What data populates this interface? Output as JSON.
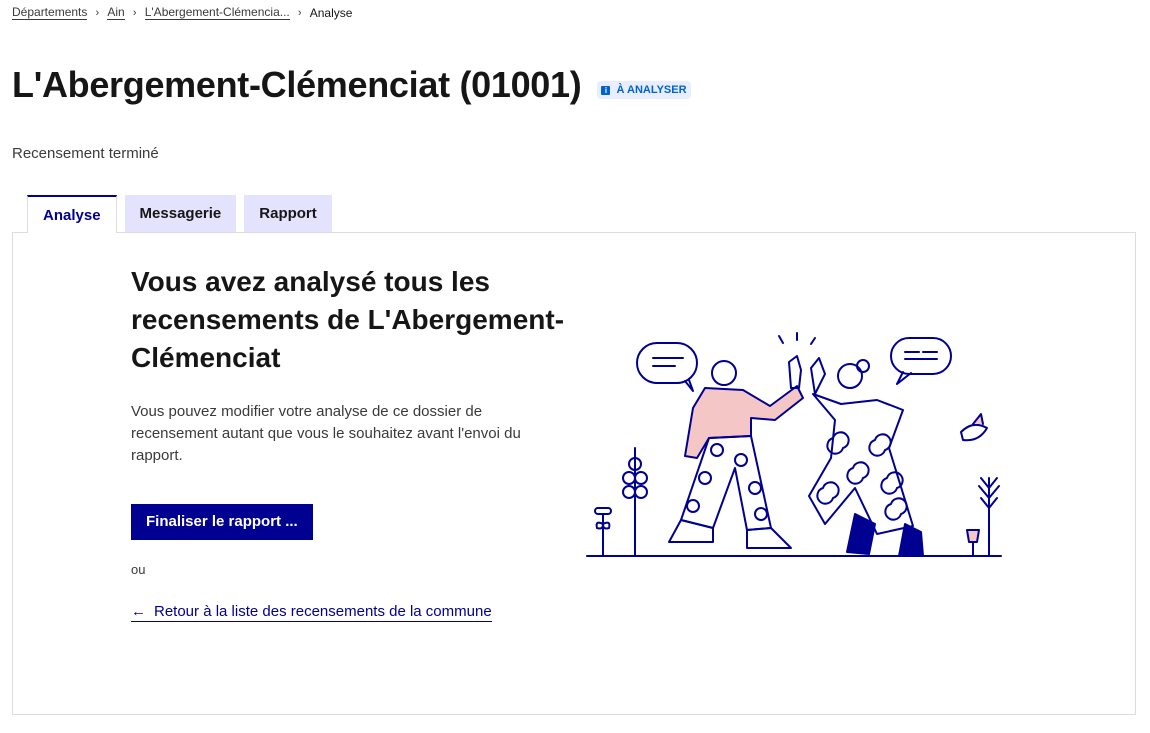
{
  "breadcrumb": {
    "items": [
      "Départements",
      "Ain",
      "L'Abergement-Clémencia..."
    ],
    "current": "Analyse"
  },
  "header": {
    "title": "L'Abergement-Clémenciat (01001)",
    "badge": "À ANALYSER",
    "subtitle": "Recensement terminé"
  },
  "tabs": [
    {
      "label": "Analyse",
      "active": true
    },
    {
      "label": "Messagerie",
      "active": false
    },
    {
      "label": "Rapport",
      "active": false
    }
  ],
  "main": {
    "heading": "Vous avez analysé tous les recensements de L'Abergement-Clémenciat",
    "description": "Vous pouvez modifier votre analyse de ce dossier de recensement autant que vous le souhaitez avant l'envoi du rapport.",
    "primary_button": "Finaliser le rapport ...",
    "or_text": "ou",
    "back_link": "Retour à la liste des recensements de la commune"
  },
  "colors": {
    "primary": "#000091",
    "tab_inactive": "#e3e3fd",
    "badge_bg": "#e8edff",
    "badge_text": "#0063cb",
    "illustration_pink": "#f4c6c6"
  },
  "icons": {
    "breadcrumb_separator": "chevron-right-icon",
    "badge": "info-icon",
    "back": "arrow-left-icon"
  }
}
